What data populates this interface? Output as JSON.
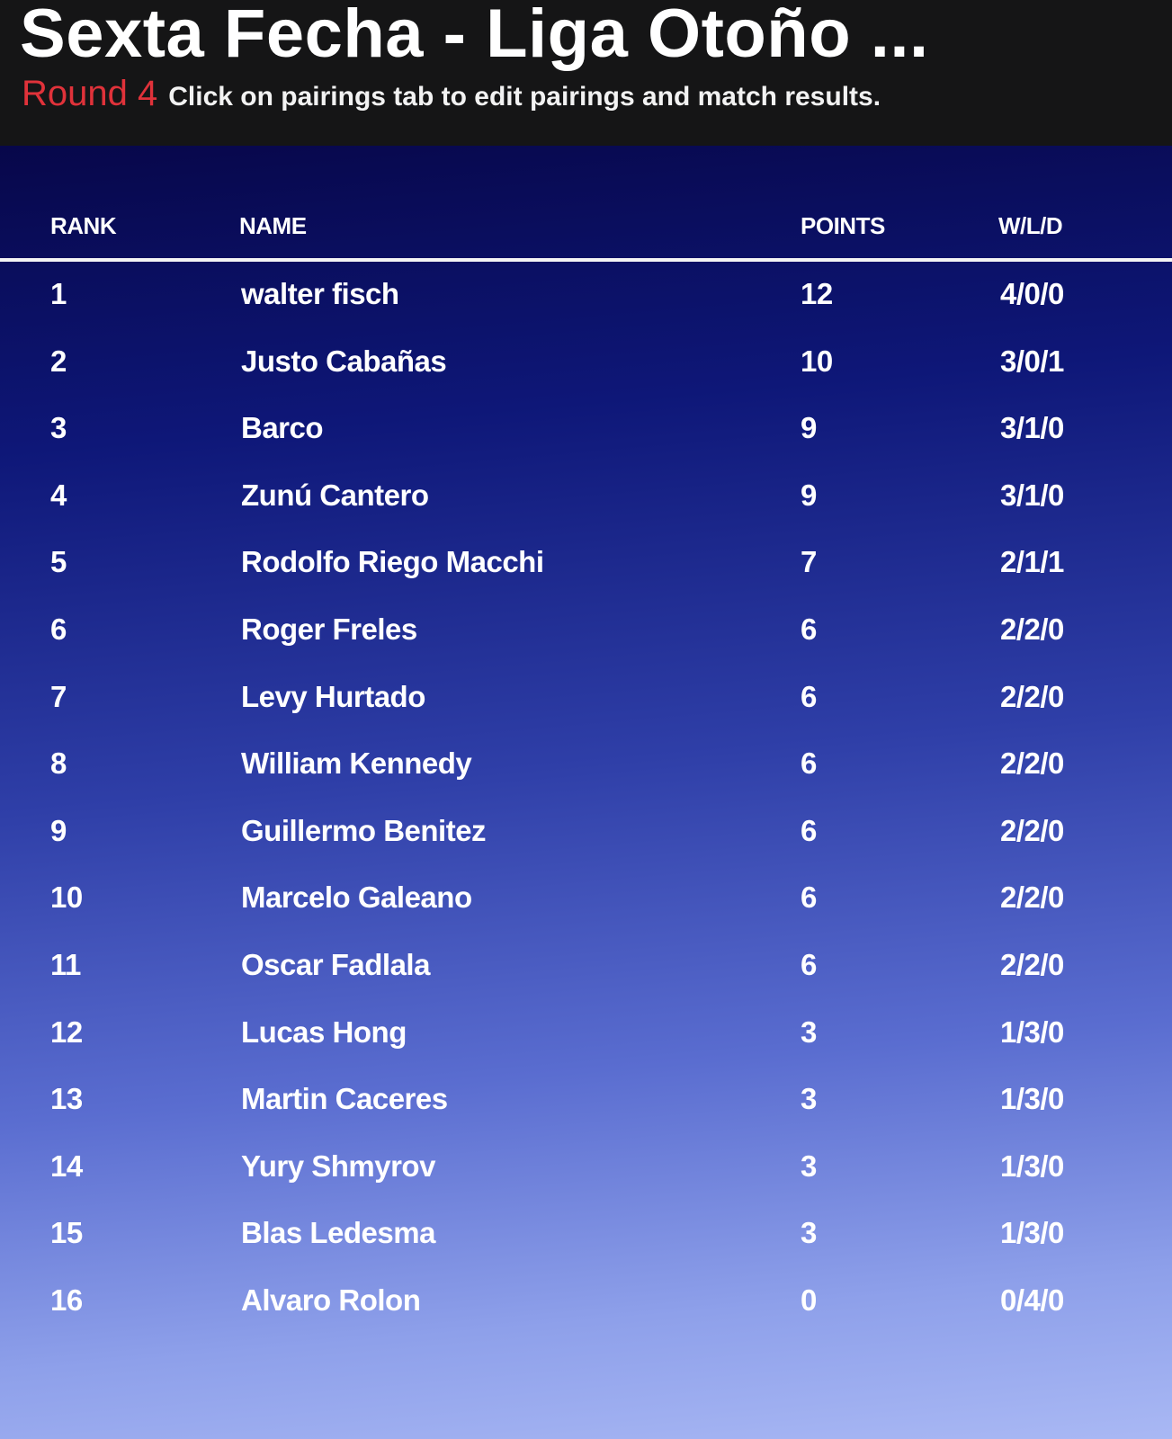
{
  "header": {
    "title": "Sexta Fecha - Liga Otoño ...",
    "round_label": "Round 4",
    "instructions": "Click on pairings tab to edit pairings and match results."
  },
  "table": {
    "columns": {
      "rank": "RANK",
      "name": "NAME",
      "points": "POINTS",
      "wld": "W/L/D"
    },
    "rows": [
      {
        "rank": "1",
        "name": "walter fisch",
        "points": "12",
        "wld": "4/0/0"
      },
      {
        "rank": "2",
        "name": "Justo Cabañas",
        "points": "10",
        "wld": "3/0/1"
      },
      {
        "rank": "3",
        "name": "Barco",
        "points": "9",
        "wld": "3/1/0"
      },
      {
        "rank": "4",
        "name": "Zunú Cantero",
        "points": "9",
        "wld": "3/1/0"
      },
      {
        "rank": "5",
        "name": "Rodolfo Riego Macchi",
        "points": "7",
        "wld": "2/1/1"
      },
      {
        "rank": "6",
        "name": "Roger Freles",
        "points": "6",
        "wld": "2/2/0"
      },
      {
        "rank": "7",
        "name": "Levy Hurtado",
        "points": "6",
        "wld": "2/2/0"
      },
      {
        "rank": "8",
        "name": "William Kennedy",
        "points": "6",
        "wld": "2/2/0"
      },
      {
        "rank": "9",
        "name": "Guillermo Benitez",
        "points": "6",
        "wld": "2/2/0"
      },
      {
        "rank": "10",
        "name": "Marcelo Galeano",
        "points": "6",
        "wld": "2/2/0"
      },
      {
        "rank": "11",
        "name": "Oscar Fadlala",
        "points": "6",
        "wld": "2/2/0"
      },
      {
        "rank": "12",
        "name": "Lucas Hong",
        "points": "3",
        "wld": "1/3/0"
      },
      {
        "rank": "13",
        "name": "Martin Caceres",
        "points": "3",
        "wld": "1/3/0"
      },
      {
        "rank": "14",
        "name": "Yury Shmyrov",
        "points": "3",
        "wld": "1/3/0"
      },
      {
        "rank": "15",
        "name": "Blas Ledesma",
        "points": "3",
        "wld": "1/3/0"
      },
      {
        "rank": "16",
        "name": "Alvaro Rolon",
        "points": "0",
        "wld": "0/4/0"
      }
    ]
  },
  "colors": {
    "header_bg": "#151516",
    "round_accent": "#e0323a",
    "panel_top": "#07074a",
    "panel_bottom": "#a9b8f4",
    "text": "#ffffff"
  }
}
